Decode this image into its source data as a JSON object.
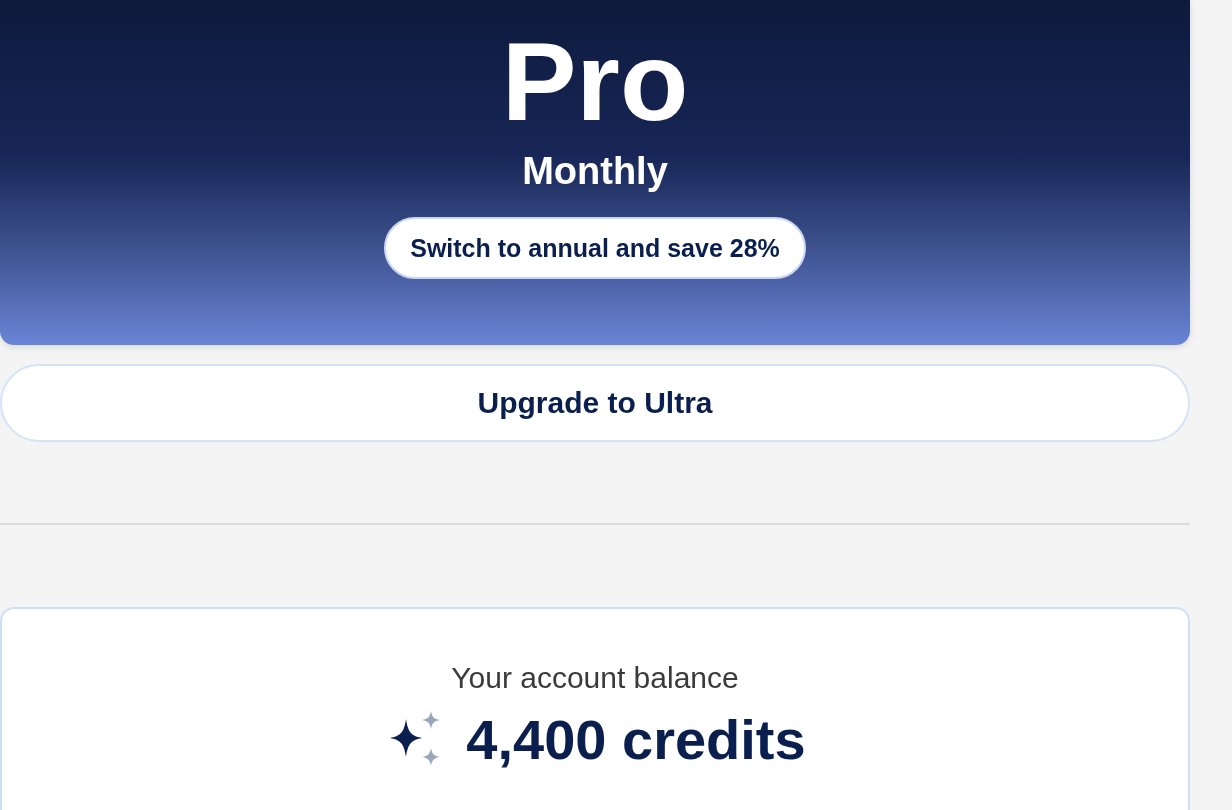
{
  "plan": {
    "name": "Pro",
    "billing": "Monthly",
    "switch_button": "Switch to annual and save 28%"
  },
  "upgrade_button": "Upgrade to Ultra",
  "balance": {
    "label": "Your account balance",
    "amount": "4,400 credits"
  }
}
